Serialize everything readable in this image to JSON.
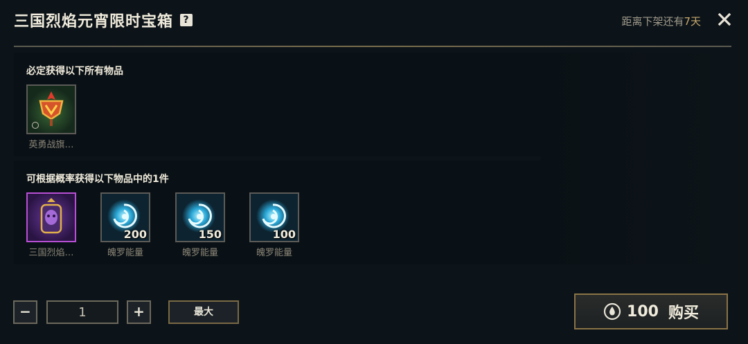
{
  "header": {
    "title": "三国烈焰元宵限时宝箱",
    "help_icon_text": "?",
    "expiry_prefix": "距离下架还有",
    "expiry_days": "7天",
    "close_icon": "close-icon"
  },
  "guaranteed": {
    "title": "必定获得以下所有物品",
    "items": [
      {
        "name": "英勇战旗…",
        "icon": "banner-icon",
        "qty": ""
      }
    ]
  },
  "random": {
    "title": "可根据概率获得以下物品中的1件",
    "items": [
      {
        "name": "三国烈焰…",
        "icon": "emote-icon",
        "qty": ""
      },
      {
        "name": "魄罗能量",
        "icon": "poro-energy-icon",
        "qty": "200"
      },
      {
        "name": "魄罗能量",
        "icon": "poro-energy-icon",
        "qty": "150"
      },
      {
        "name": "魄罗能量",
        "icon": "poro-energy-icon",
        "qty": "100"
      }
    ]
  },
  "controls": {
    "minus_label": "−",
    "quantity_value": "1",
    "plus_label": "+",
    "max_label": "最大"
  },
  "purchase": {
    "price": "100",
    "label": "购买",
    "currency_icon": "currency-icon"
  },
  "colors": {
    "background": "#0d1419",
    "accent_gold": "#c8aa6e",
    "epic_border": "#b84fd4"
  }
}
